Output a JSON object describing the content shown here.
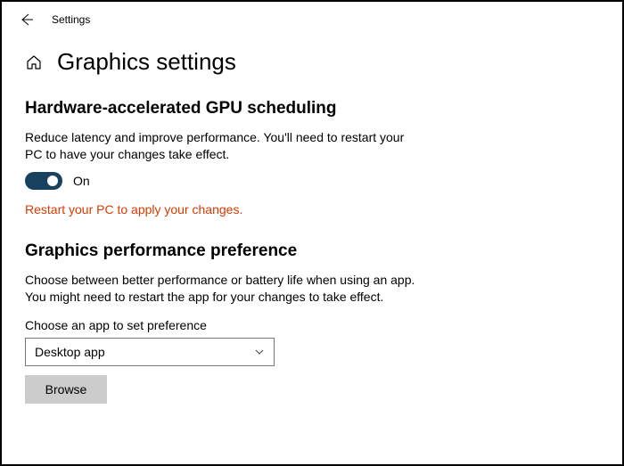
{
  "topbar": {
    "title": "Settings"
  },
  "header": {
    "page_title": "Graphics settings"
  },
  "gpu_scheduling": {
    "heading": "Hardware-accelerated GPU scheduling",
    "description": "Reduce latency and improve performance. You'll need to restart your PC to have your changes take effect.",
    "toggle_state": "On",
    "warning": "Restart your PC to apply your changes."
  },
  "performance_pref": {
    "heading": "Graphics performance preference",
    "description": "Choose between better performance or battery life when using an app. You might need to restart the app for your changes to take effect.",
    "choose_label": "Choose an app to set preference",
    "selected_option": "Desktop app",
    "browse_label": "Browse"
  }
}
